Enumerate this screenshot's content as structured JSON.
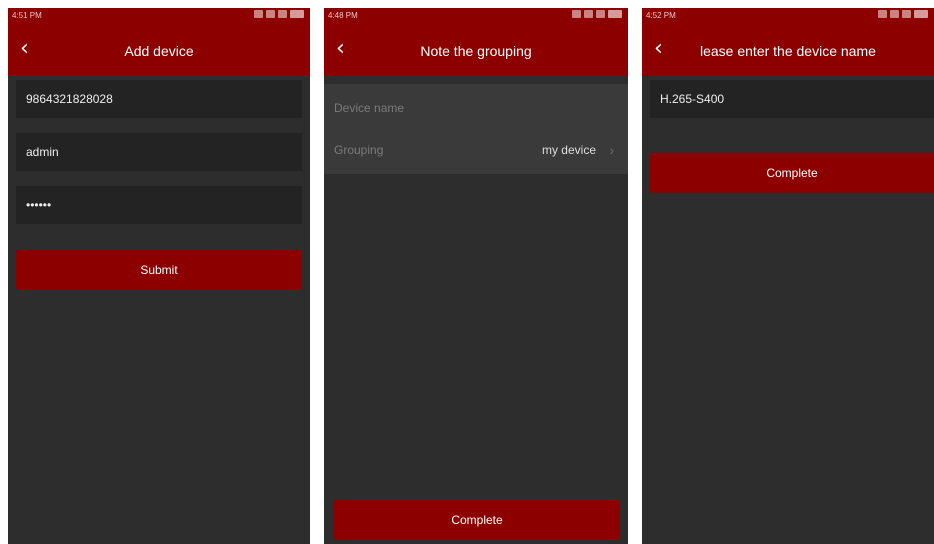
{
  "screens": [
    {
      "status_time": "4:51 PM",
      "title": "Add device",
      "fields": [
        "9864321828028",
        "admin",
        "••••••"
      ],
      "submit_label": "Submit"
    },
    {
      "status_time": "4:48 PM",
      "title": "Note the grouping",
      "rows": [
        {
          "label": "Device name",
          "value": ""
        },
        {
          "label": "Grouping",
          "value": "my device"
        }
      ],
      "complete_label": "Complete"
    },
    {
      "status_time": "4:52 PM",
      "title": "lease enter the device name",
      "device_name_value": "H.265-S400",
      "complete_label": "Complete"
    }
  ],
  "icons": {
    "back": "chevron-left-icon",
    "row_arrow": "chevron-right-icon",
    "status": [
      "sim-icon",
      "wifi-icon",
      "signal-icon",
      "signal-icon",
      "battery-icon"
    ]
  },
  "colors": {
    "accent": "#8c0000",
    "background": "#2d2d2d",
    "field": "#232323"
  }
}
